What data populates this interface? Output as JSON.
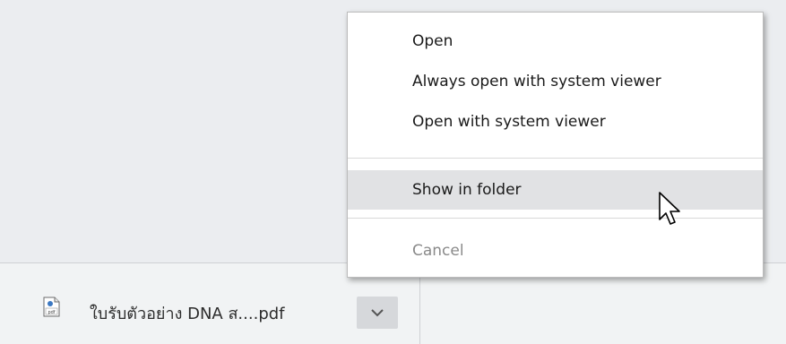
{
  "download_bar": {
    "file_name": "ใบรับตัวอย่าง DNA ส....pdf",
    "file_icon": "pdf-file-icon",
    "menu_button_icon": "chevron-down-icon"
  },
  "context_menu": {
    "items": [
      {
        "label": "Open",
        "enabled": true
      },
      {
        "label": "Always open with system viewer",
        "enabled": true
      },
      {
        "label": "Open with system viewer",
        "enabled": true
      },
      {
        "label": "Show in folder",
        "enabled": true,
        "highlighted": true
      },
      {
        "label": "Cancel",
        "enabled": false
      }
    ]
  },
  "cursor": "mouse-pointer-icon"
}
